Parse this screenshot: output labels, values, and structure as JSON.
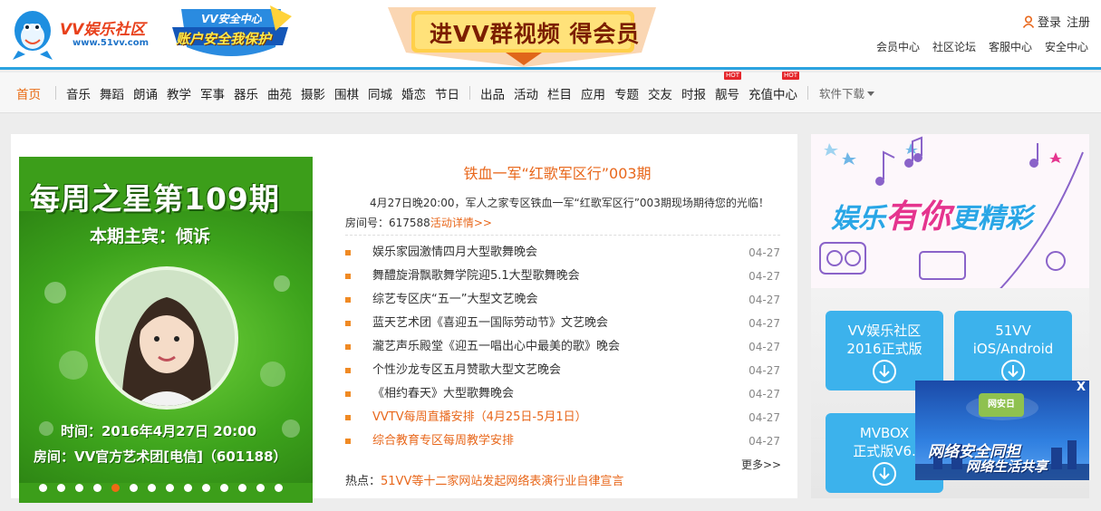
{
  "header": {
    "logo_title": "VV娱乐社区",
    "logo_url": "www.51vv.com",
    "shield_line1": "VV安全中心",
    "shield_line2": "账户安全我保护",
    "banner_text": "进VV群视频 得会员",
    "login": "登录",
    "register": "注册",
    "links": [
      "会员中心",
      "社区论坛",
      "客服中心",
      "安全中心"
    ]
  },
  "nav": {
    "home": "首页",
    "group1": [
      "音乐",
      "舞蹈",
      "朗诵",
      "教学",
      "军事",
      "器乐",
      "曲苑",
      "摄影",
      "围棋",
      "同城",
      "婚恋",
      "节日"
    ],
    "group2": [
      "出品",
      "活动",
      "栏目",
      "应用",
      "专题",
      "交友",
      "时报",
      "靓号",
      "充值中心"
    ],
    "hot_badge": "HOT",
    "software": "软件下载"
  },
  "poster": {
    "title": "每周之星第109期",
    "host": "本期主宾：倾诉",
    "time": "时间：2016年4月27日  20:00",
    "room": "房间：VV官方艺术团[电信]（601188）",
    "dot_count": 14,
    "active_dot": 4
  },
  "feature": {
    "headline": "铁血一军“红歌军区行”003期",
    "intro": "4月27日晚20:00，军人之家专区铁血一军“红歌军区行”003期现场期待您的光临！",
    "room_label": "房间号：617588",
    "detail_link": "活动详情>>"
  },
  "news": [
    {
      "title": "娱乐家园激情四月大型歌舞晚会",
      "date": "04-27",
      "highlight": false
    },
    {
      "title": "舞醴旋滑飘歌舞学院迎5.1大型歌舞晚会",
      "date": "04-27",
      "highlight": false
    },
    {
      "title": "综艺专区庆“五一”大型文艺晚会",
      "date": "04-27",
      "highlight": false
    },
    {
      "title": "蓝天艺术团《喜迎五一国际劳动节》文艺晚会",
      "date": "04-27",
      "highlight": false
    },
    {
      "title": "瀧艺声乐殿堂《迎五一唱出心中最美的歌》晚会",
      "date": "04-27",
      "highlight": false
    },
    {
      "title": "个性沙龙专区五月赞歌大型文艺晚会",
      "date": "04-27",
      "highlight": false
    },
    {
      "title": "《相约春天》大型歌舞晚会",
      "date": "04-27",
      "highlight": false
    },
    {
      "title": "VVTV每周直播安排（4月25日-5月1日）",
      "date": "04-27",
      "highlight": true
    },
    {
      "title": "综合教育专区每周教学安排",
      "date": "04-27",
      "highlight": true
    }
  ],
  "more": "更多>>",
  "hotline": {
    "label": "热点：",
    "text": "51VV等十二家网站发起网络表演行业自律宣言"
  },
  "right": {
    "slogan_a": "娱乐",
    "slogan_b": "有你",
    "slogan_c": "更精彩",
    "downloads": [
      {
        "line1": "VV娱乐社区",
        "line2": "2016正式版"
      },
      {
        "line1": "51VV",
        "line2": "iOS/Android"
      },
      {
        "line1": "MVBOX",
        "line2": "正式版V6."
      }
    ],
    "popup_close": "X",
    "popup_badge": "网安日",
    "popup_line1": "网络安全同担",
    "popup_line2": "网络生活共享"
  },
  "colors": {
    "accent": "#e8671b",
    "blue": "#2ba3e0",
    "green": "#3c9e1a"
  }
}
